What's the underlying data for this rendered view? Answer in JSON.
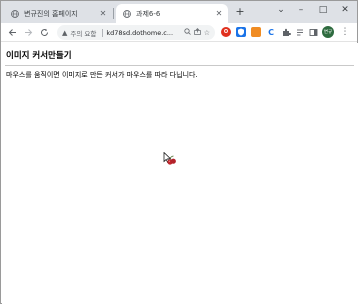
{
  "browser": {
    "tabs": [
      {
        "title": "변규진의 홈페이지",
        "active": false
      },
      {
        "title": "과제6-6",
        "active": true
      }
    ],
    "new_tab_glyph": "+",
    "window_controls": {
      "minimize": "–",
      "maximize": "□",
      "close": "✕"
    },
    "chevron": "⌄"
  },
  "toolbar": {
    "security_label": "주의 요함",
    "url": "kd78sd.dothome.c...",
    "avatar_initials": "변규"
  },
  "page": {
    "heading": "이미지 커서만들기",
    "description": "마우스를 움직이면 이미지로 만든 커서가 마우스를 따라 다닙니다."
  },
  "colors": {
    "tabstrip": "#dee1e6",
    "omnibox": "#f1f3f4",
    "cherry": "#c0262d",
    "avatar": "#2e6b3f"
  }
}
